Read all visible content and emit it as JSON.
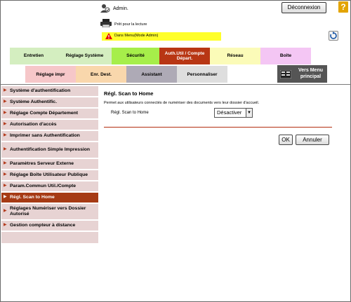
{
  "header": {
    "admin_label": "Admin.",
    "logout_label": "Déconnexion",
    "help_label": "?",
    "status": "Prêt pour la lecture",
    "mode": "Dans Menu(Mode Admin)"
  },
  "tabs": [
    {
      "label": "Entretien",
      "color": "#d4eec0"
    },
    {
      "label": "Réglage Système",
      "color": "#d4eec0"
    },
    {
      "label": "Sécurité",
      "color": "#a6ee4a"
    },
    {
      "label": "Auth.Util / Compte Départ.",
      "color": "#b83614"
    },
    {
      "label": "Réseau",
      "color": "#fbfbb8"
    },
    {
      "label": "Boîte",
      "color": "#f4c6f4"
    }
  ],
  "subtabs": [
    {
      "label": "Réglage impr",
      "color": "#f6c7c9"
    },
    {
      "label": "Enr. Dest.",
      "color": "#f9d7ac"
    },
    {
      "label": "Assistant",
      "color": "#aeaab6"
    },
    {
      "label": "Personnaliser",
      "color": "#dedede"
    }
  ],
  "menu_button": {
    "label": "Vers Menu principal"
  },
  "sidebar": {
    "items": [
      {
        "label": "Système d'authentification"
      },
      {
        "label": "Système Authentific."
      },
      {
        "label": "Réglage Compte Département"
      },
      {
        "label": "Autorisation d'accès"
      },
      {
        "label": "Imprimer sans Authentification"
      },
      {
        "label": "Authentification Simple Impression"
      },
      {
        "label": "Paramètres Serveur Externe"
      },
      {
        "label": "Réglage Boîte Utilisateur Publique"
      },
      {
        "label": "Param.Commun Util./Compte"
      },
      {
        "label": "Régl. Scan to Home"
      },
      {
        "label": "Réglages Numériser vers Dossier Autorisé"
      },
      {
        "label": "Gestion compteur à distance"
      }
    ]
  },
  "content": {
    "title": "Régl. Scan to Home",
    "description": "Permet aux utilisateurs connectés de numériser des documents vers leur dossier d'accueil.",
    "field_label": "Régl. Scan to Home",
    "field_value": "Désactiver",
    "ok_label": "OK",
    "cancel_label": "Annuler"
  }
}
